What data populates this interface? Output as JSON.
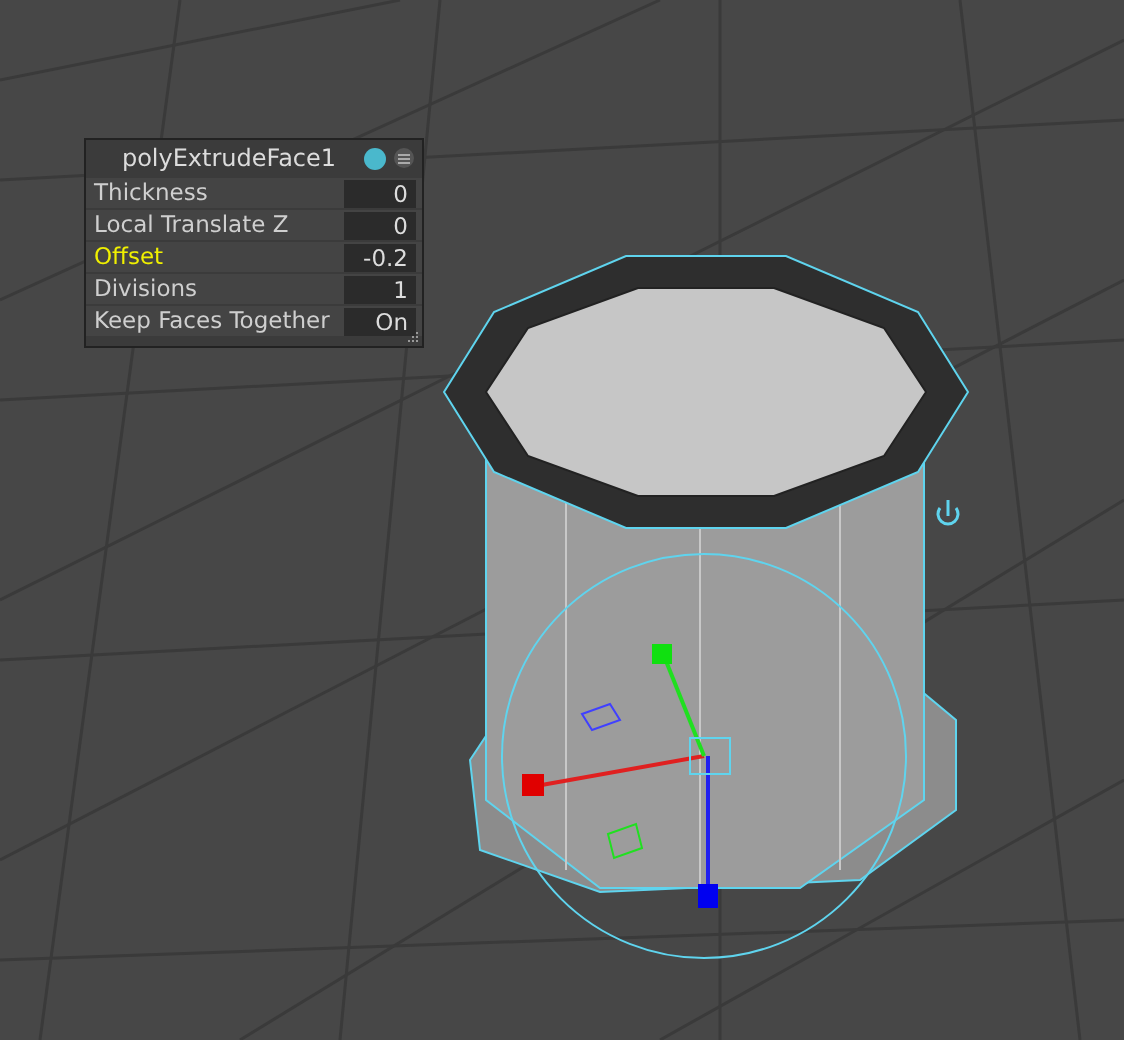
{
  "panel": {
    "title": "polyExtrudeFace1",
    "attributes": [
      {
        "label": "Thickness",
        "value": "0",
        "selected": false
      },
      {
        "label": "Local Translate Z",
        "value": "0",
        "selected": false
      },
      {
        "label": "Offset",
        "value": "-0.2",
        "selected": true
      },
      {
        "label": "Divisions",
        "value": "1",
        "selected": false
      },
      {
        "label": "Keep Faces Together",
        "value": "On",
        "selected": false
      }
    ]
  }
}
